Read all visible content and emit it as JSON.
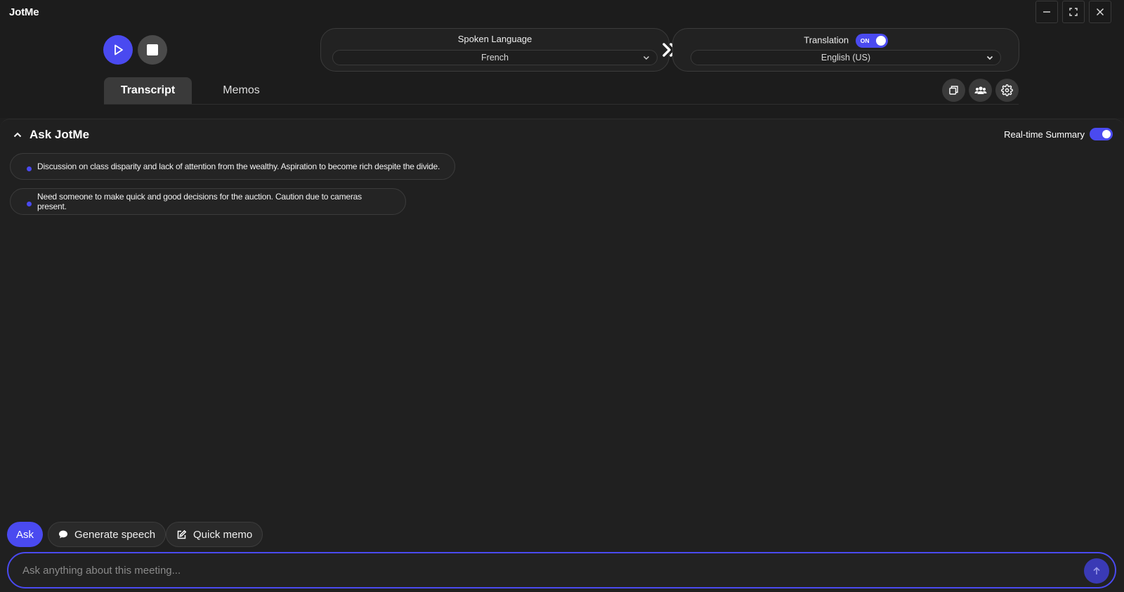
{
  "app": {
    "title": "JotMe"
  },
  "window_controls": {
    "minimize": "minimize-icon",
    "maximize": "maximize-icon",
    "close": "close-icon"
  },
  "controls": {
    "play": "play-icon",
    "stop": "stop-icon"
  },
  "spoken_language": {
    "label": "Spoken Language",
    "value": "French"
  },
  "translation": {
    "label": "Translation",
    "toggle_text": "ON",
    "value": "English (US)"
  },
  "tabs": [
    {
      "label": "Transcript",
      "active": true
    },
    {
      "label": "Memos",
      "active": false
    }
  ],
  "toolbar_icons": [
    "copy-icon",
    "people-icon",
    "settings-icon"
  ],
  "ask_panel": {
    "title": "Ask JotMe",
    "realtime_summary_label": "Real-time Summary",
    "summaries": [
      "Discussion on class disparity and lack of attention from the wealthy. Aspiration to become rich despite the divide.",
      "Need someone to make quick and good decisions for the auction. Caution due to cameras present."
    ]
  },
  "actions": {
    "ask": "Ask",
    "generate_speech": "Generate speech",
    "quick_memo": "Quick memo"
  },
  "input": {
    "placeholder": "Ask anything about this meeting..."
  },
  "colors": {
    "accent": "#4a4af0",
    "background": "#1f1f1f"
  }
}
